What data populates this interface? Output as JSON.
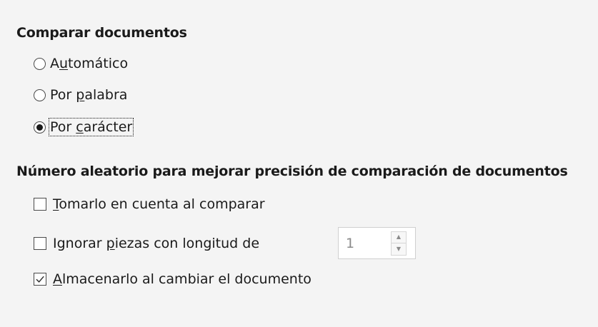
{
  "compare": {
    "title": "Comparar documentos",
    "options": [
      {
        "pre": "A",
        "accel": "u",
        "post": "tomático",
        "selected": false
      },
      {
        "pre": "Por ",
        "accel": "p",
        "post": "alabra",
        "selected": false
      },
      {
        "pre": "Por ",
        "accel": "c",
        "post": "arácter",
        "selected": true
      }
    ]
  },
  "random": {
    "title": "Número aleatorio para mejorar precisión de comparación de documentos",
    "take_into_account": {
      "pre": "",
      "accel": "T",
      "post": "omarlo en cuenta al comparar",
      "checked": false
    },
    "ignore_pieces": {
      "pre": "Ignorar ",
      "accel": "p",
      "post": "iezas con longitud de",
      "checked": false
    },
    "store": {
      "pre": "",
      "accel": "A",
      "post": "lmacenarlo al cambiar el documento",
      "checked": true
    },
    "length_value": "1"
  },
  "icons": {
    "spin_up": "chevron-up-icon",
    "spin_down": "chevron-down-icon",
    "check": "checkmark-icon"
  }
}
